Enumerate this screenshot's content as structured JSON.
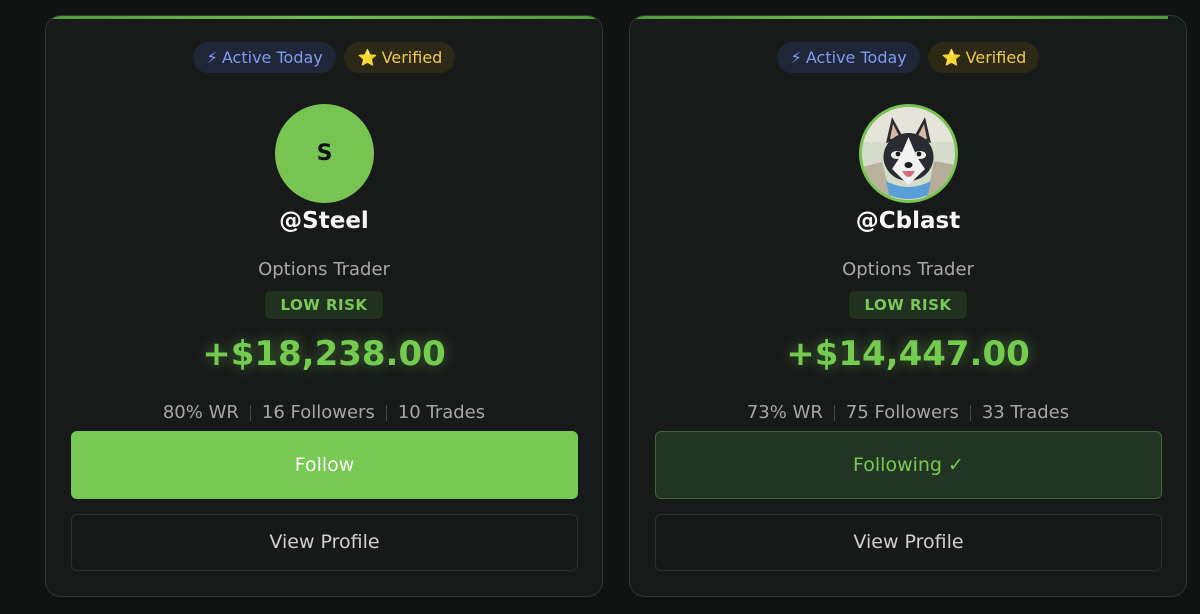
{
  "traders": [
    {
      "badges": {
        "active_icon": "⚡",
        "active_label": "Active Today",
        "verified_icon": "⭐",
        "verified_label": "Verified"
      },
      "avatar_letter": "S",
      "handle": "@Steel",
      "role": "Options Trader",
      "risk": "LOW RISK",
      "pnl": "+$18,238.00",
      "win_rate": "80% WR",
      "followers": "16 Followers",
      "trades": "10 Trades",
      "primary_button": "Follow",
      "secondary_button": "View Profile"
    },
    {
      "badges": {
        "active_icon": "⚡",
        "active_label": "Active Today",
        "verified_icon": "⭐",
        "verified_label": "Verified"
      },
      "avatar_image": "husky-dog-photo",
      "handle": "@Cblast",
      "role": "Options Trader",
      "risk": "LOW RISK",
      "pnl": "+$14,447.00",
      "win_rate": "73% WR",
      "followers": "75 Followers",
      "trades": "33 Trades",
      "primary_button": "Following ✓",
      "secondary_button": "View Profile"
    }
  ],
  "colors": {
    "accent_green": "#78c954",
    "active_blue": "#7f9df0",
    "verified_gold": "#f2c94c",
    "card_bg": "#181a1a",
    "page_bg": "#111212"
  }
}
